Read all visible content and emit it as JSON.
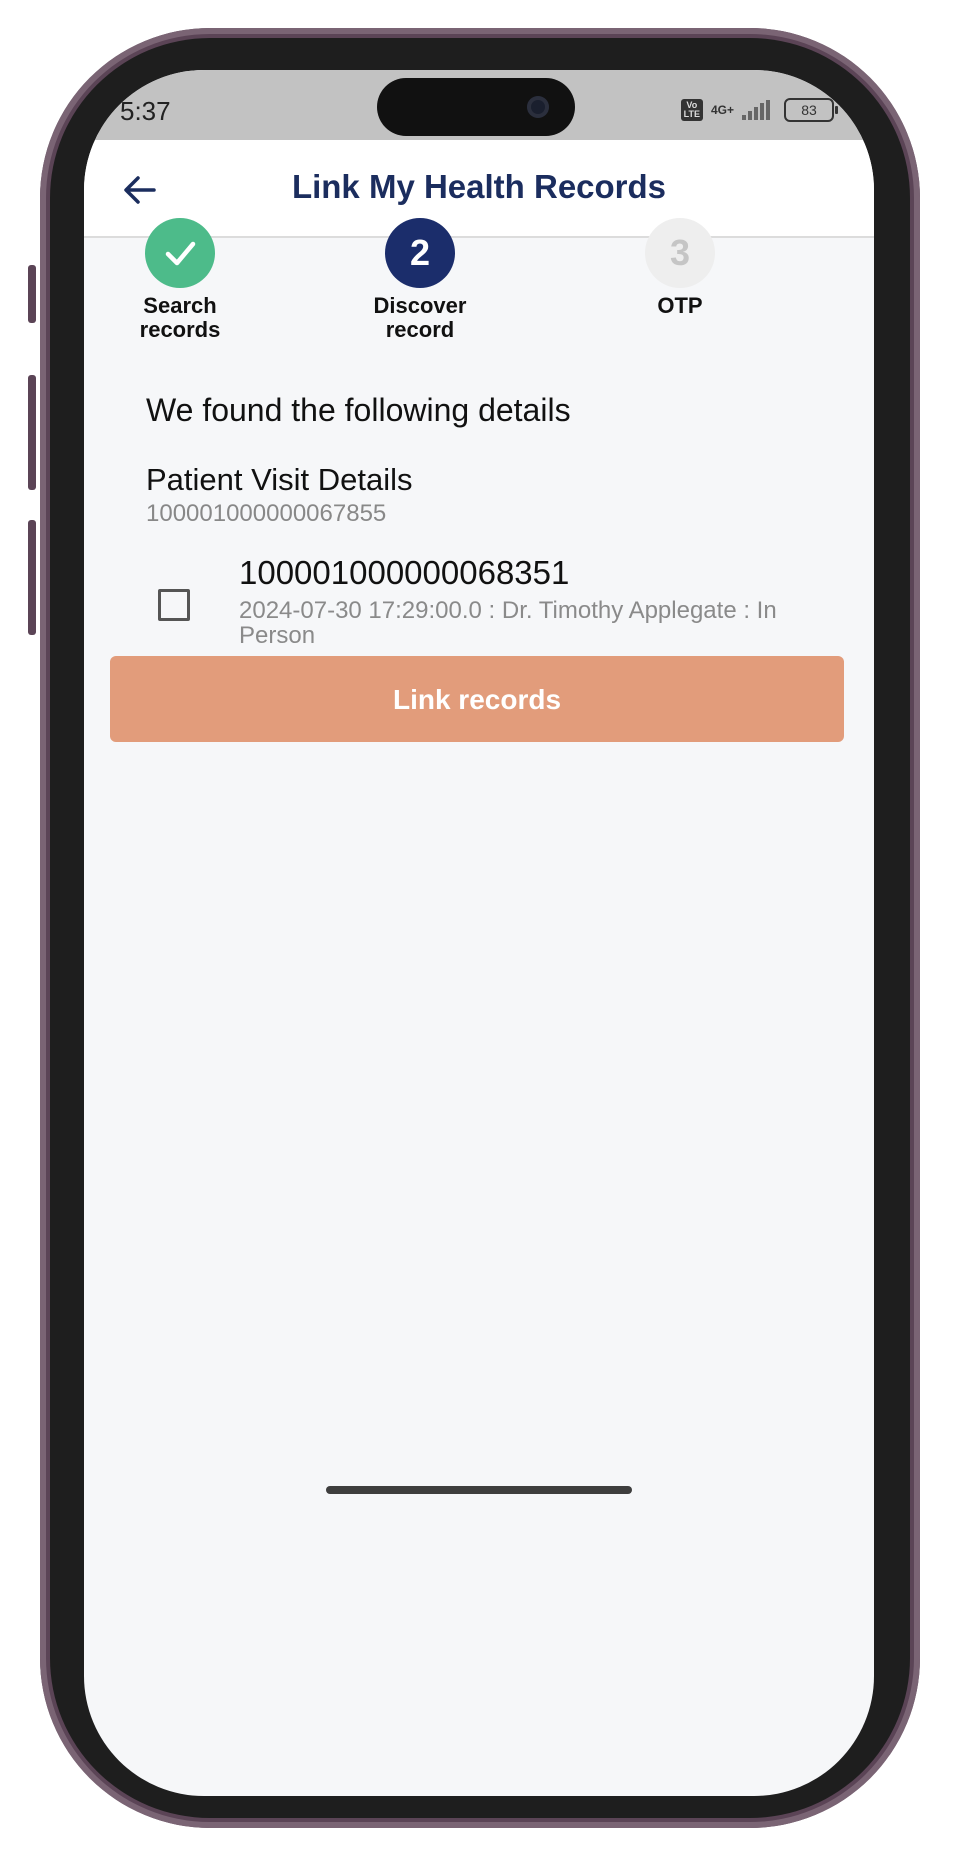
{
  "status_bar": {
    "time": "5:37",
    "volte": "Vo LTE",
    "network": "4G+",
    "battery": "83"
  },
  "app_bar": {
    "title": "Link My Health Records",
    "back_icon": "arrow-left-icon"
  },
  "stepper": {
    "steps": [
      {
        "label": "Search\nrecords",
        "state": "done",
        "icon": "check-icon"
      },
      {
        "number": "2",
        "label": "Discover\nrecord",
        "state": "active"
      },
      {
        "number": "3",
        "label": "OTP",
        "state": "pending"
      }
    ]
  },
  "content": {
    "heading": "We found the following details",
    "section_title": "Patient Visit Details",
    "section_id": "100001000000067855",
    "records": [
      {
        "id": "100001000000068351",
        "detail": "2024-07-30 17:29:00.0 : Dr. Timothy Applegate : In Person",
        "checked": false
      }
    ],
    "link_button": "Link records"
  },
  "colors": {
    "primary": "#1b2d6b",
    "success": "#4dbb8a",
    "button": "#e29c7b",
    "background": "#f6f7f9"
  }
}
